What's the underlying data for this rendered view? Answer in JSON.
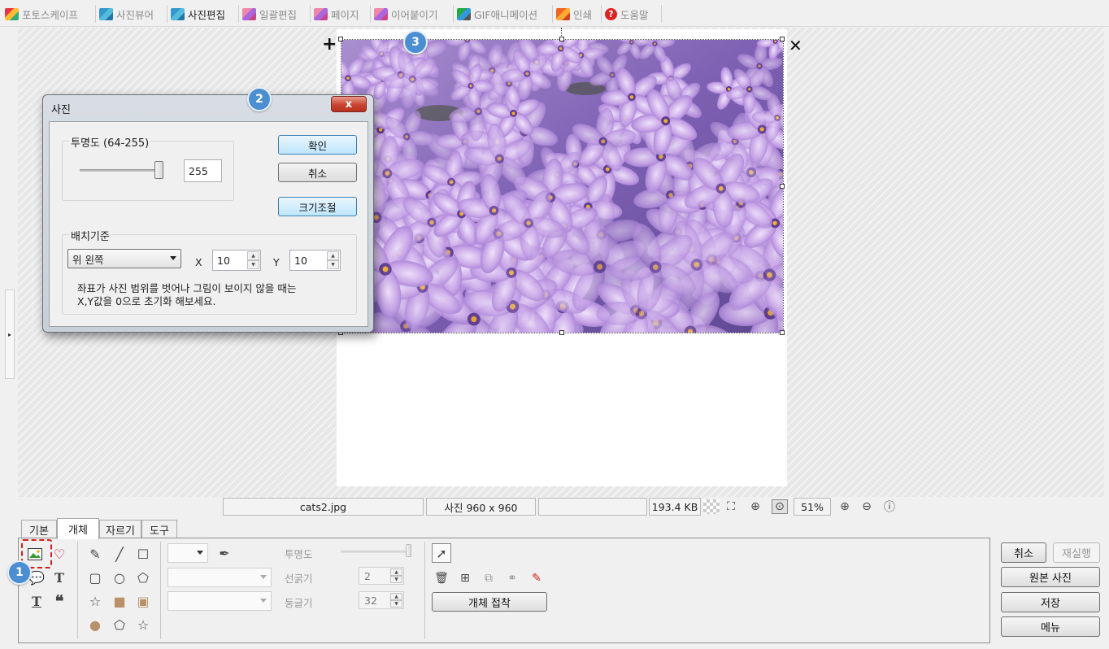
{
  "top_tabs": [
    {
      "label": "포토스케이프",
      "icon": "book-icon"
    },
    {
      "label": "사진뷰어",
      "icon": "camera-icon"
    },
    {
      "label": "사진편집",
      "icon": "camera-icon"
    },
    {
      "label": "일괄편집",
      "icon": "grid-icon"
    },
    {
      "label": "페이지",
      "icon": "grid-icon"
    },
    {
      "label": "이어붙이기",
      "icon": "grid-icon"
    },
    {
      "label": "GIF애니메이션",
      "icon": "gif-icon"
    },
    {
      "label": "인쇄",
      "icon": "printer-icon"
    },
    {
      "label": "도움말",
      "icon": "help-icon"
    }
  ],
  "active_top_tab": "사진편집",
  "badges": [
    "1",
    "2",
    "3"
  ],
  "dialog": {
    "title": "사진",
    "close_label": "x",
    "opacity_group_label": "투명도 (64-255)",
    "opacity_value": "255",
    "opacity_fraction": 1.0,
    "ok_label": "확인",
    "cancel_label": "취소",
    "resize_label": "크기조절",
    "placement_group_label": "배치기준",
    "placement_value": "위 왼쪽",
    "x_label": "X",
    "x_value": "10",
    "y_label": "Y",
    "y_value": "10",
    "hint_line1": "좌표가 사진 범위를 벗어나 그림이 보이지 않을 때는",
    "hint_line2": "X,Y값을 0으로 초기화 해보세요."
  },
  "status": {
    "filename": "cats2.jpg",
    "dimensions": "사진 960 x 960",
    "filesize": "193.4 KB",
    "zoom": "51%"
  },
  "bottom_tabs": [
    "기본",
    "개체",
    "자르기",
    "도구"
  ],
  "active_bottom_tab": "개체",
  "object_panel": {
    "opacity_label": "투명도",
    "line_width_label": "선굵기",
    "line_width_value": "2",
    "roundness_label": "둥글기",
    "roundness_value": "32",
    "attach_button_label": "개체 접착"
  },
  "right_buttons": {
    "undo_label": "취소",
    "redo_label": "재실행",
    "original_label": "원본 사진",
    "save_label": "저장",
    "menu_label": "메뉴"
  },
  "colors": {
    "badge": "#4b8ed2",
    "selection_dash": "#d0201a",
    "close_button": "#c8442f"
  }
}
